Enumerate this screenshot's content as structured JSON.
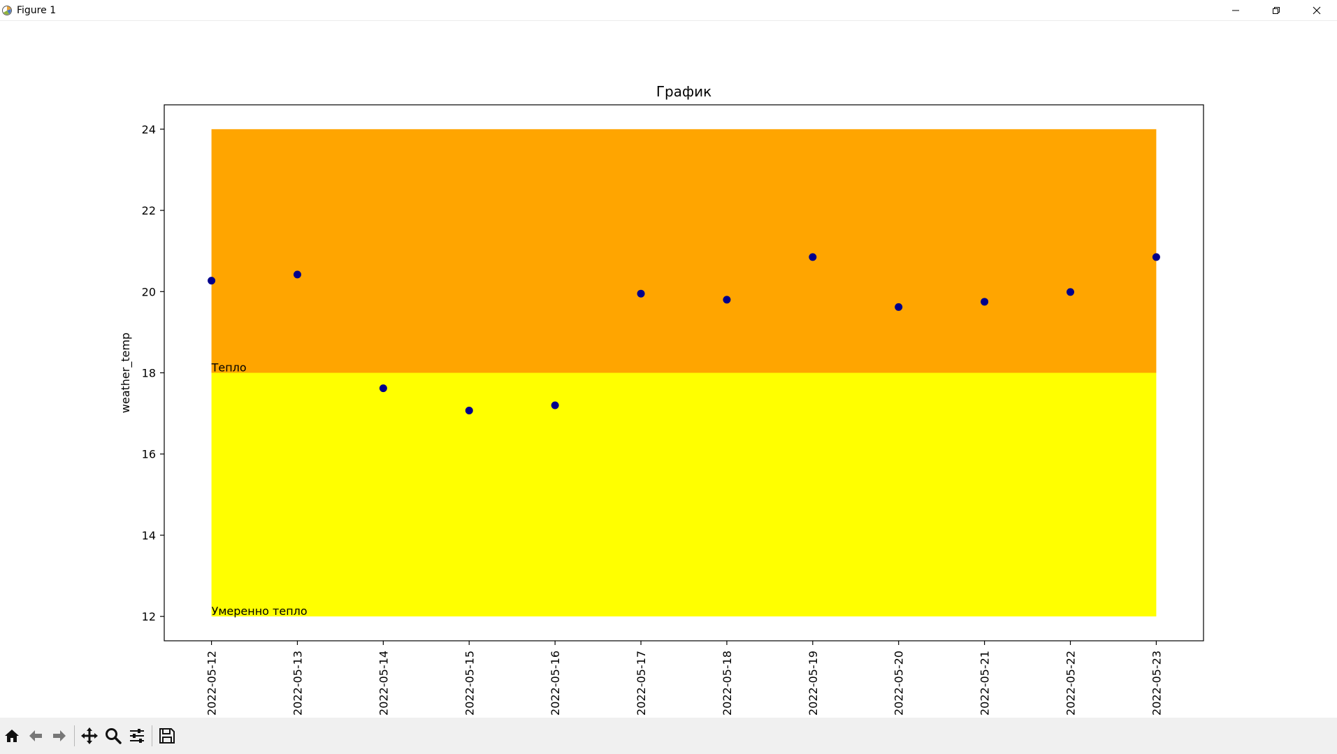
{
  "window": {
    "title": "Figure 1",
    "app_icon": "matplotlib-icon",
    "controls": [
      "minimize-icon",
      "restore-icon",
      "close-icon"
    ]
  },
  "toolbar": {
    "buttons": [
      "home-icon",
      "back-arrow-icon",
      "forward-arrow-icon",
      "pan-icon",
      "zoom-icon",
      "configure-subplots-icon",
      "save-icon"
    ]
  },
  "chart_data": {
    "type": "scatter",
    "title": "График",
    "xlabel": "",
    "ylabel": "weather_temp",
    "x_type": "date",
    "x": [
      "2022-05-12",
      "2022-05-13",
      "2022-05-14",
      "2022-05-15",
      "2022-05-16",
      "2022-05-17",
      "2022-05-18",
      "2022-05-19",
      "2022-05-20",
      "2022-05-21",
      "2022-05-22",
      "2022-05-23"
    ],
    "y": [
      20.27,
      20.42,
      17.62,
      17.07,
      17.2,
      19.95,
      19.8,
      20.85,
      19.62,
      19.75,
      19.99,
      20.85
    ],
    "ylim": [
      11.4,
      24.6
    ],
    "yticks": [
      12,
      14,
      16,
      18,
      20,
      22,
      24
    ],
    "marker_color": "#00008b",
    "bands": [
      {
        "label": "Умеренно тепло",
        "ymin": 12,
        "ymax": 18,
        "color": "#ffff00"
      },
      {
        "label": "Тепло",
        "ymin": 18,
        "ymax": 24,
        "color": "#ffa500"
      }
    ],
    "grid": false,
    "legend": "none",
    "xtick_rotation": "vertical"
  }
}
